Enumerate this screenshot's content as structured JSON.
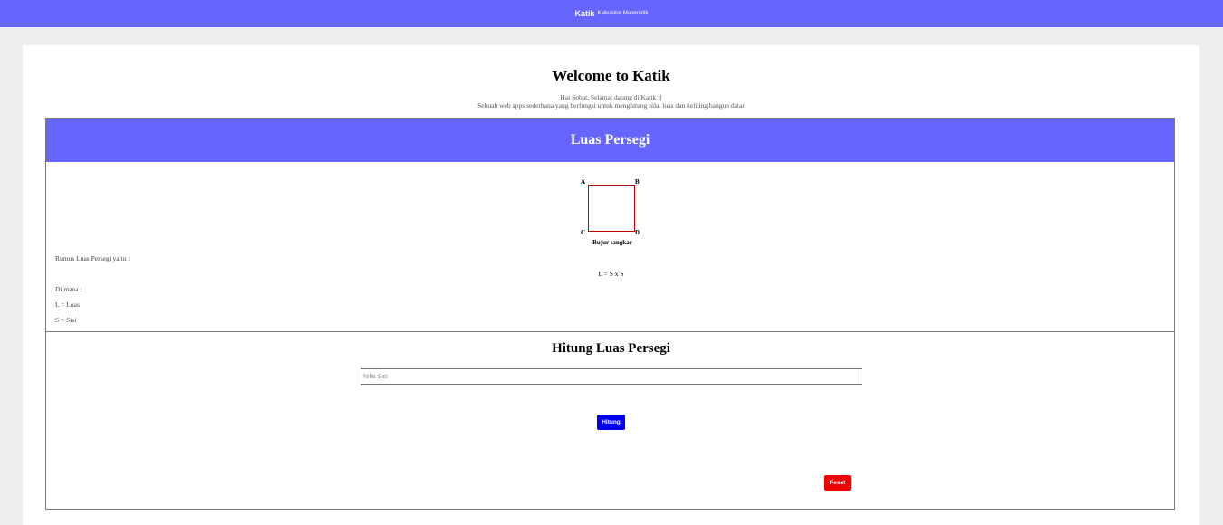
{
  "header": {
    "brand": "Katik",
    "subtitle": "Kalkulator Matematik",
    "background_color": "#6666ff"
  },
  "welcome": {
    "title": "Welcome to Katik",
    "line1": "Hai Sobat, Selamat datang di Katik :]",
    "line2": "Sebuah web apps sederhana yang berfungsi untuk menghitung nilai luas dan keliling bangun datar"
  },
  "panel": {
    "title": "Luas Persegi",
    "diagram": {
      "vertex_a": "A",
      "vertex_b": "B",
      "vertex_c": "C",
      "vertex_d": "D",
      "caption": "Bujur sangkar",
      "border_color": "#c00000"
    },
    "rumus_label": "Rumus Luas Persegi yaitu :",
    "formula": "L = S x S",
    "dimana": "Di mana :",
    "def_l": "L = Luas",
    "def_s": "S = Sisi"
  },
  "calc": {
    "title": "Hitung Luas Persegi",
    "input_placeholder": "Nilai Sisi",
    "input_value": "",
    "hitung_label": "Hitung",
    "reset_label": "Reset",
    "hitung_color": "#0000ee",
    "reset_color": "#ee0000"
  }
}
